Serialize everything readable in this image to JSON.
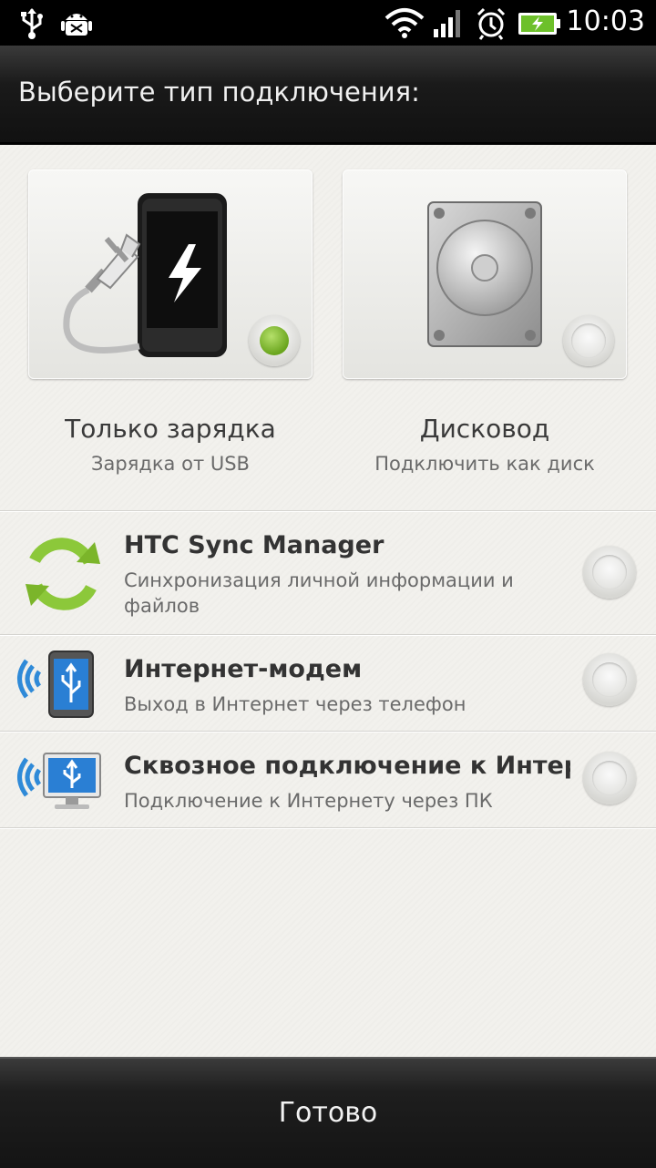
{
  "status_bar": {
    "time": "10:03",
    "icons": [
      "usb-icon",
      "android-debug-icon",
      "wifi-icon",
      "signal-icon",
      "alarm-icon",
      "battery-charging-icon"
    ]
  },
  "header": {
    "title": "Выберите тип подключения:"
  },
  "cards": [
    {
      "title": "Только зарядка",
      "subtitle": "Зарядка от USB",
      "icon": "charger-phone-icon",
      "selected": true
    },
    {
      "title": "Дисковод",
      "subtitle": "Подключить как диск",
      "icon": "hard-drive-icon",
      "selected": false
    }
  ],
  "options": [
    {
      "title": "HTC Sync Manager",
      "subtitle": "Синхронизация личной информации и файлов",
      "icon": "sync-icon",
      "selected": false
    },
    {
      "title": "Интернет-модем",
      "subtitle": "Выход в Интернет через телефон",
      "icon": "usb-modem-phone-icon",
      "selected": false
    },
    {
      "title": "Сквозное подключение к Интернету",
      "subtitle": "Подключение к Интернету через ПК",
      "icon": "internet-pass-through-icon",
      "selected": false
    }
  ],
  "footer": {
    "done_label": "Готово"
  },
  "colors": {
    "selected_accent": "#7bb52a",
    "header_bg": "#1a1a1a",
    "content_bg": "#f2f1ed"
  }
}
